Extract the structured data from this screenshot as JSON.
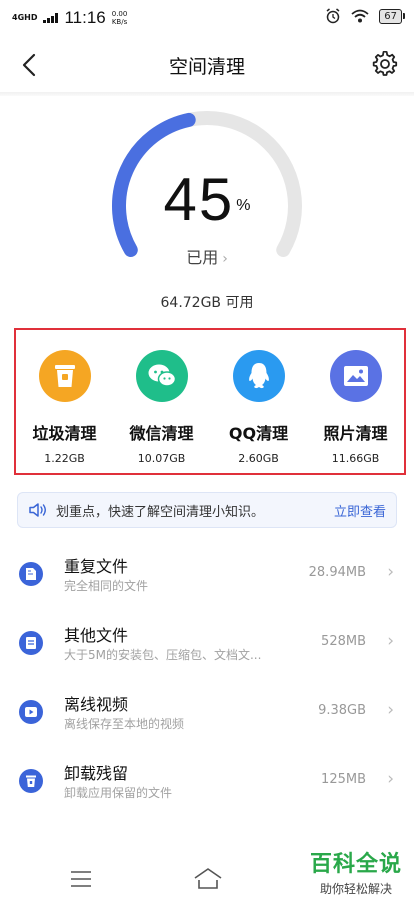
{
  "status_bar": {
    "network": "4GHD",
    "time": "11:16",
    "speed_value": "0.00",
    "speed_unit": "KB/s",
    "battery": "67"
  },
  "header": {
    "title": "空间清理"
  },
  "gauge": {
    "percent": "45",
    "percent_sign": "%",
    "used_fraction": 0.45,
    "used_label": "已用",
    "chevron": "›",
    "available": "64.72GB 可用",
    "accent_color": "#4a6fe0",
    "track_color": "#e6e6e6"
  },
  "categories": [
    {
      "name": "垃圾清理",
      "size": "1.22GB",
      "icon": "trash-bin-icon",
      "color": "#f5a623"
    },
    {
      "name": "微信清理",
      "size": "10.07GB",
      "icon": "wechat-icon",
      "color": "#1fbe8a"
    },
    {
      "name": "QQ清理",
      "size": "2.60GB",
      "icon": "qq-penguin-icon",
      "color": "#2a9af0"
    },
    {
      "name": "照片清理",
      "size": "11.66GB",
      "icon": "photo-icon",
      "color": "#5a72e4"
    }
  ],
  "tip": {
    "text": "划重点，快速了解空间清理小知识。",
    "link": "立即查看",
    "icon": "speaker-icon"
  },
  "files": [
    {
      "title": "重复文件",
      "desc": "完全相同的文件",
      "size": "28.94MB",
      "icon": "duplicate-file-icon"
    },
    {
      "title": "其他文件",
      "desc": "大于5M的安装包、压缩包、文档文...",
      "size": "528MB",
      "icon": "document-icon"
    },
    {
      "title": "离线视频",
      "desc": "离线保存至本地的视频",
      "size": "9.38GB",
      "icon": "video-icon"
    },
    {
      "title": "卸载残留",
      "desc": "卸载应用保留的文件",
      "size": "125MB",
      "icon": "trash-icon"
    }
  ],
  "chevron": "›",
  "watermark": {
    "title": "百科全说",
    "subtitle": "助你轻松解决"
  }
}
